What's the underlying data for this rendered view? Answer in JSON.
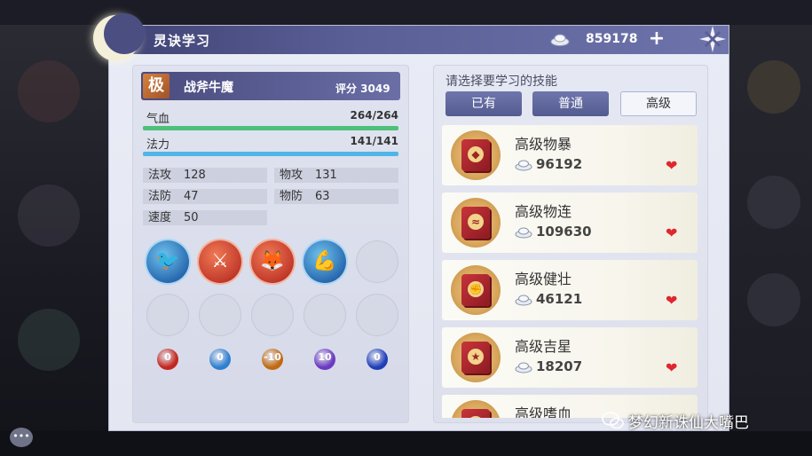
{
  "window": {
    "title": "灵诀学习",
    "currency_value": "859178",
    "plus_label": "+"
  },
  "character": {
    "rank_badge": "极",
    "name": "战斧牛魔",
    "score": "评分 3049",
    "hp_label": "气血",
    "hp_value": "264/264",
    "hp_fill": 1.0,
    "mp_label": "法力",
    "mp_value": "141/141",
    "mp_fill": 1.0,
    "stats": [
      {
        "label": "法攻",
        "value": "128"
      },
      {
        "label": "物攻",
        "value": "131"
      },
      {
        "label": "法防",
        "value": "47"
      },
      {
        "label": "物防",
        "value": "63"
      },
      {
        "label": "速度",
        "value": "50"
      }
    ],
    "orbs": [
      "0",
      "0",
      "-10",
      "10",
      "0"
    ],
    "colors": {
      "hp_bar": "#4dc07a",
      "mp_bar": "#4fb6e8",
      "orb_red": "#c2271f",
      "orb_blue": "#2f7fd0",
      "orb_orange": "#c06a12",
      "orb_purple": "#6a3bc0",
      "orb_navy": "#1f3fb8"
    }
  },
  "skills_panel": {
    "prompt": "请选择要学习的技能",
    "tabs": [
      "已有",
      "普通",
      "高级"
    ],
    "active_tab": "高级",
    "items": [
      {
        "name": "高级物暴",
        "cost": "96192",
        "emblem": "◆"
      },
      {
        "name": "高级物连",
        "cost": "109630",
        "emblem": "≈"
      },
      {
        "name": "高级健壮",
        "cost": "46121",
        "emblem": "✊"
      },
      {
        "name": "高级吉星",
        "cost": "18207",
        "emblem": "★"
      },
      {
        "name": "高级嗜血",
        "cost": "",
        "emblem": "◆"
      }
    ]
  },
  "watermark": "梦幻新诛仙大嘴巴",
  "icons": {
    "currency": "silver-ingot-icon",
    "close": "close-icon",
    "heart": "heart-icon",
    "chat": "chat-icon"
  }
}
